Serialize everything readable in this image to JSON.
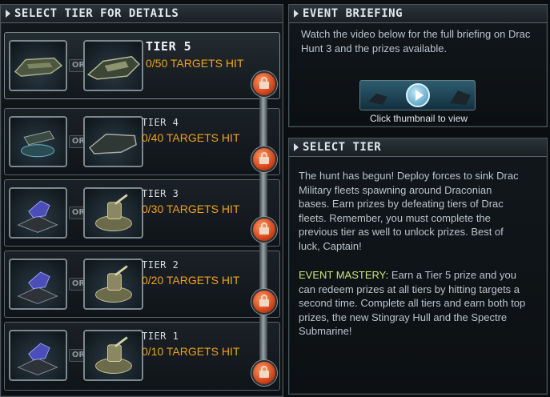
{
  "left_panel": {
    "title": "SELECT TIER FOR DETAILS"
  },
  "or_label": "OR",
  "tiers": [
    {
      "name": "TIER 5",
      "progress": "0/50 TARGETS HIT",
      "icon_a": "warship-icon",
      "icon_b": "stingray-hull-icon"
    },
    {
      "name": "TIER 4",
      "progress": "0/40 TARGETS HIT",
      "icon_a": "turret-icon",
      "icon_b": "hull-icon"
    },
    {
      "name": "TIER 3",
      "progress": "0/30 TARGETS HIT",
      "icon_a": "gun-mount-icon",
      "icon_b": "cannon-turret-icon"
    },
    {
      "name": "TIER 2",
      "progress": "0/20 TARGETS HIT",
      "icon_a": "gun-mount-icon",
      "icon_b": "cannon-turret-icon"
    },
    {
      "name": "TIER 1",
      "progress": "0/10 TARGETS HIT",
      "icon_a": "gun-mount-icon",
      "icon_b": "cannon-turret-icon"
    }
  ],
  "event_briefing": {
    "title": "EVENT BRIEFING",
    "text": "Watch the video below for the full briefing on Drac Hunt 3 and the prizes available.",
    "caption": "Click thumbnail to view"
  },
  "select_tier": {
    "title": "SELECT TIER",
    "text": "The hunt has begun! Deploy forces to sink Drac Military fleets spawning around Draconian bases. Earn prizes by defeating tiers of Drac fleets. Remember, you must complete the previous tier as well to unlock prizes. Best of luck, Captain!",
    "mastery_label": "EVENT MASTERY:",
    "mastery_text": " Earn a Tier 5 prize and you can redeem prizes at all tiers by hitting targets a second time. Complete all tiers and earn both top prizes, the new Stingray Hull and the Spectre Submarine!"
  },
  "colors": {
    "accent_orange": "#f0a21e",
    "mastery_green": "#c8e77a",
    "lock_red": "#d4461c"
  }
}
